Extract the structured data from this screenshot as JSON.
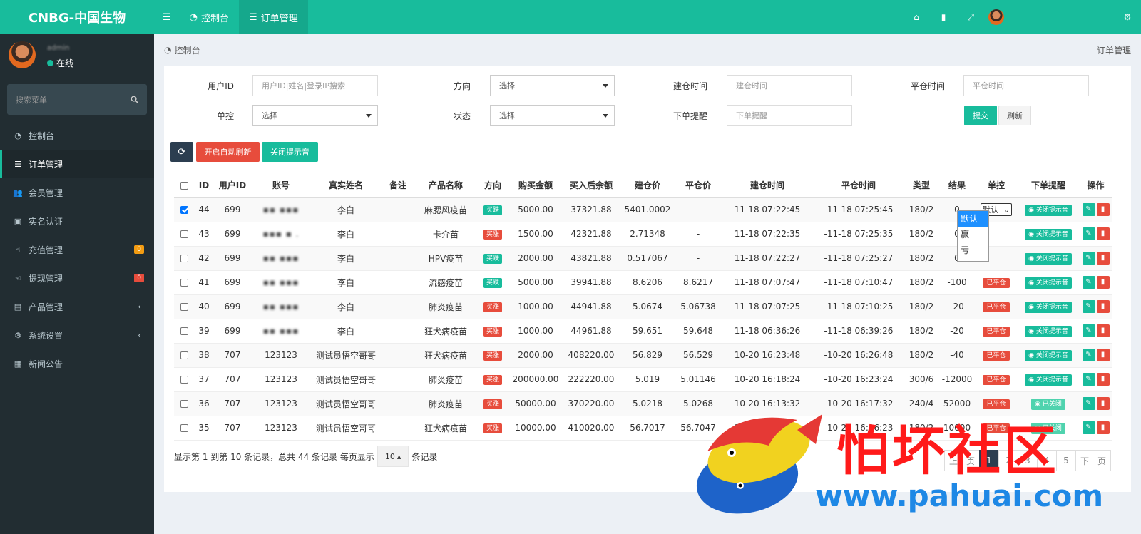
{
  "app": {
    "brand": "CNBG-中国生物"
  },
  "user": {
    "name": "admin",
    "status": "在线"
  },
  "sidebar": {
    "search_placeholder": "搜索菜单",
    "items": [
      {
        "label": "控制台",
        "icon": "dashboard-icon"
      },
      {
        "label": "订单管理",
        "icon": "list-icon",
        "active": true
      },
      {
        "label": "会员管理",
        "icon": "users-icon"
      },
      {
        "label": "实名认证",
        "icon": "id-card-icon"
      },
      {
        "label": "充值管理",
        "icon": "hand-icon",
        "badge": "0",
        "badge_color": "#f39c12"
      },
      {
        "label": "提现管理",
        "icon": "hand-icon",
        "badge": "0",
        "badge_color": "#e74c3c"
      },
      {
        "label": "产品管理",
        "icon": "briefcase-icon",
        "caret": "‹"
      },
      {
        "label": "系统设置",
        "icon": "cogs-icon",
        "caret": "‹"
      },
      {
        "label": "新闻公告",
        "icon": "newspaper-icon"
      }
    ]
  },
  "topbar": {
    "tabs": [
      {
        "label": "控制台"
      },
      {
        "label": "订单管理"
      }
    ]
  },
  "breadcrumb": {
    "home": "控制台",
    "current": "订单管理"
  },
  "filters": {
    "user_id_label": "用户ID",
    "user_id_placeholder": "用户ID|姓名|登录IP搜索",
    "direction_label": "方向",
    "direction_value": "选择",
    "open_time_label": "建仓时间",
    "open_time_placeholder": "建仓时间",
    "close_time_label": "平仓时间",
    "close_time_placeholder": "平仓时间",
    "control_label": "单控",
    "control_value": "选择",
    "status_label": "状态",
    "status_value": "选择",
    "remind_label": "下单提醒",
    "remind_placeholder": "下单提醒",
    "submit": "提交",
    "reset": "刷新"
  },
  "toolbar": {
    "auto_refresh": "开启自动刷新",
    "mute": "关闭提示音"
  },
  "table": {
    "headers": [
      "ID",
      "用户ID",
      "账号",
      "真实姓名",
      "备注",
      "产品名称",
      "方向",
      "购买金额",
      "买入后余额",
      "建仓价",
      "平仓价",
      "建仓时间",
      "平仓时间",
      "类型",
      "结果",
      "单控",
      "下单提醒",
      "操作"
    ],
    "rows": [
      {
        "checked": true,
        "id": "44",
        "uid": "699",
        "account": "▪▪ ▪▪▪",
        "name": "李白",
        "note": "",
        "product": "麻腮风疫苗",
        "dir": "买跌",
        "dir_type": "buy",
        "amount": "5000.00",
        "balance": "37321.88",
        "open": "5401.0002",
        "close": "-",
        "open_time": "11-18 07:22:45",
        "close_time": "-11-18 07:25:45",
        "type": "180/2",
        "result": "0",
        "closed": false,
        "ctl": "默认",
        "remind": "关闭提示音",
        "remind_off": false
      },
      {
        "checked": false,
        "id": "43",
        "uid": "699",
        "account": "▪▪▪ ▪ .",
        "name": "李白",
        "note": "",
        "product": "卡介苗",
        "dir": "买涨",
        "dir_type": "sell",
        "amount": "1500.00",
        "balance": "42321.88",
        "open": "2.71348",
        "close": "-",
        "open_time": "11-18 07:22:35",
        "close_time": "-11-18 07:25:35",
        "type": "180/2",
        "result": "0",
        "closed": false,
        "ctl": "",
        "remind": "关闭提示音",
        "remind_off": false
      },
      {
        "checked": false,
        "id": "42",
        "uid": "699",
        "account": "▪▪ ▪▪▪",
        "name": "李白",
        "note": "",
        "product": "HPV疫苗",
        "dir": "买跌",
        "dir_type": "buy",
        "amount": "2000.00",
        "balance": "43821.88",
        "open": "0.517067",
        "close": "-",
        "open_time": "11-18 07:22:27",
        "close_time": "-11-18 07:25:27",
        "type": "180/2",
        "result": "0",
        "closed": false,
        "ctl": "",
        "remind": "关闭提示音",
        "remind_off": false
      },
      {
        "checked": false,
        "id": "41",
        "uid": "699",
        "account": "▪▪ ▪▪▪",
        "name": "李白",
        "note": "",
        "product": "流感疫苗",
        "dir": "买跌",
        "dir_type": "buy",
        "amount": "5000.00",
        "balance": "39941.88",
        "open": "8.6206",
        "close": "8.6217",
        "open_time": "11-18 07:07:47",
        "close_time": "-11-18 07:10:47",
        "type": "180/2",
        "result": "-100",
        "closed": true,
        "ctl": "",
        "remind": "关闭提示音",
        "remind_off": false
      },
      {
        "checked": false,
        "id": "40",
        "uid": "699",
        "account": "▪▪ ▪▪▪",
        "name": "李白",
        "note": "",
        "product": "肺炎疫苗",
        "dir": "买涨",
        "dir_type": "sell",
        "amount": "1000.00",
        "balance": "44941.88",
        "open": "5.0674",
        "close": "5.06738",
        "open_time": "11-18 07:07:25",
        "close_time": "-11-18 07:10:25",
        "type": "180/2",
        "result": "-20",
        "closed": true,
        "ctl": "",
        "remind": "关闭提示音",
        "remind_off": false
      },
      {
        "checked": false,
        "id": "39",
        "uid": "699",
        "account": "▪▪ ▪▪▪",
        "name": "李白",
        "note": "",
        "product": "狂犬病疫苗",
        "dir": "买涨",
        "dir_type": "sell",
        "amount": "1000.00",
        "balance": "44961.88",
        "open": "59.651",
        "close": "59.648",
        "open_time": "11-18 06:36:26",
        "close_time": "-11-18 06:39:26",
        "type": "180/2",
        "result": "-20",
        "closed": true,
        "ctl": "",
        "remind": "关闭提示音",
        "remind_off": false
      },
      {
        "checked": false,
        "id": "38",
        "uid": "707",
        "account": "123123",
        "name": "测试员悟空哥哥",
        "note": "",
        "product": "狂犬病疫苗",
        "dir": "买涨",
        "dir_type": "sell",
        "amount": "2000.00",
        "balance": "408220.00",
        "open": "56.829",
        "close": "56.529",
        "open_time": "10-20 16:23:48",
        "close_time": "-10-20 16:26:48",
        "type": "180/2",
        "result": "-40",
        "closed": true,
        "ctl": "",
        "remind": "关闭提示音",
        "remind_off": false
      },
      {
        "checked": false,
        "id": "37",
        "uid": "707",
        "account": "123123",
        "name": "测试员悟空哥哥",
        "note": "",
        "product": "肺炎疫苗",
        "dir": "买涨",
        "dir_type": "sell",
        "amount": "200000.00",
        "balance": "222220.00",
        "open": "5.019",
        "close": "5.01146",
        "open_time": "10-20 16:18:24",
        "close_time": "-10-20 16:23:24",
        "type": "300/6",
        "result": "-12000",
        "closed": true,
        "ctl": "",
        "remind": "关闭提示音",
        "remind_off": false
      },
      {
        "checked": false,
        "id": "36",
        "uid": "707",
        "account": "123123",
        "name": "测试员悟空哥哥",
        "note": "",
        "product": "肺炎疫苗",
        "dir": "买涨",
        "dir_type": "sell",
        "amount": "50000.00",
        "balance": "370220.00",
        "open": "5.0218",
        "close": "5.0268",
        "open_time": "10-20 16:13:32",
        "close_time": "-10-20 16:17:32",
        "type": "240/4",
        "result": "52000",
        "closed": true,
        "ctl": "",
        "remind": "已关闭",
        "remind_off": true
      },
      {
        "checked": false,
        "id": "35",
        "uid": "707",
        "account": "123123",
        "name": "测试员悟空哥哥",
        "note": "",
        "product": "狂犬病疫苗",
        "dir": "买涨",
        "dir_type": "sell",
        "amount": "10000.00",
        "balance": "410020.00",
        "open": "56.7017",
        "close": "56.7047",
        "open_time": "10-20 16:13:23",
        "close_time": "-10-20 16:16:23",
        "type": "180/2",
        "result": "10000",
        "closed": true,
        "ctl": "",
        "remind": "已关闭",
        "remind_off": true
      }
    ],
    "closed_label": "已平仓",
    "control_options": [
      "默认",
      "赢",
      "亏"
    ]
  },
  "pager": {
    "info_prefix": "显示第 1 到第 10 条记录，总共 44 条记录 每页显示",
    "page_size": "10",
    "info_suffix": "条记录",
    "pages": [
      "上一页",
      "1",
      "2",
      "3",
      "4",
      "5",
      "下一页"
    ],
    "current": "1"
  },
  "watermark": {
    "title": "怕坏社区",
    "url": "www.pahuai.com"
  },
  "colors": {
    "brand": "#18bc9c",
    "sidebar": "#222d32",
    "danger": "#e74c3c",
    "primary_dark": "#2c3e50"
  }
}
